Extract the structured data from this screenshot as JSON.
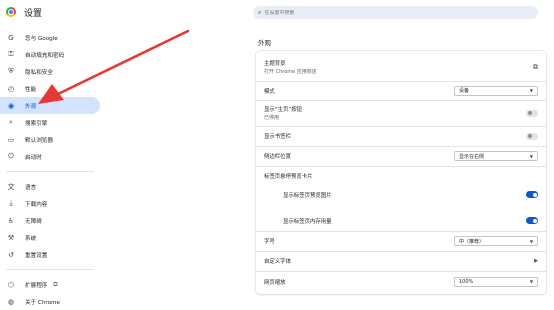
{
  "app": {
    "title": "设置"
  },
  "search": {
    "placeholder": "在设置中搜索"
  },
  "sidebar": {
    "items": [
      {
        "icon": "G",
        "icon_name": "google-icon",
        "label": "您与 Google"
      },
      {
        "icon": "⚿",
        "icon_name": "key-icon",
        "label": "自动填充和密码"
      },
      {
        "icon": "⛨",
        "icon_name": "shield-icon",
        "label": "隐私和安全"
      },
      {
        "icon": "◴",
        "icon_name": "speedometer-icon",
        "label": "性能"
      },
      {
        "icon": "◉",
        "icon_name": "palette-icon",
        "label": "外观"
      },
      {
        "icon": "⌕",
        "icon_name": "search-icon",
        "label": "搜索引擎"
      },
      {
        "icon": "▭",
        "icon_name": "browser-icon",
        "label": "默认浏览器"
      },
      {
        "icon": "⏻",
        "icon_name": "power-icon",
        "label": "启动时"
      },
      {
        "icon": "文",
        "icon_name": "language-icon",
        "label": "语言"
      },
      {
        "icon": "⤓",
        "icon_name": "download-icon",
        "label": "下载内容"
      },
      {
        "icon": "♿",
        "icon_name": "accessibility-icon",
        "label": "无障碍"
      },
      {
        "icon": "⚒",
        "icon_name": "wrench-icon",
        "label": "系统"
      },
      {
        "icon": "↺",
        "icon_name": "reset-icon",
        "label": "重置设置"
      },
      {
        "icon": "⬡",
        "icon_name": "puzzle-icon",
        "label": "扩展程序"
      },
      {
        "icon": "◍",
        "icon_name": "chrome-icon",
        "label": "关于 Chrome"
      }
    ],
    "active_index": 4
  },
  "appearance": {
    "section_title": "外观",
    "theme": {
      "label": "主题背景",
      "sub": "打开 Chrome 应用商店"
    },
    "mode": {
      "label": "模式",
      "value": "设备"
    },
    "home_button": {
      "label": "显示“主页”按钮",
      "sub": "已停用",
      "on": false
    },
    "bookmarks_bar": {
      "label": "显示书签栏",
      "on": false
    },
    "side_panel": {
      "label": "侧边栏位置",
      "value": "显示在右侧"
    },
    "tab_hover": {
      "label": "标签页悬停预览卡片"
    },
    "tab_preview_image": {
      "label": "显示标签页预览图片",
      "on": true
    },
    "tab_memory": {
      "label": "显示标签页内存用量",
      "on": true
    },
    "font_size": {
      "label": "字号",
      "value": "中（推荐）"
    },
    "custom_fonts": {
      "label": "自定义字体"
    },
    "page_zoom": {
      "label": "网页缩放",
      "value": "100%"
    }
  },
  "colors": {
    "accent": "#0b57d0",
    "active_bg": "#d3e3fd",
    "annotation_arrow": "#e53935"
  }
}
